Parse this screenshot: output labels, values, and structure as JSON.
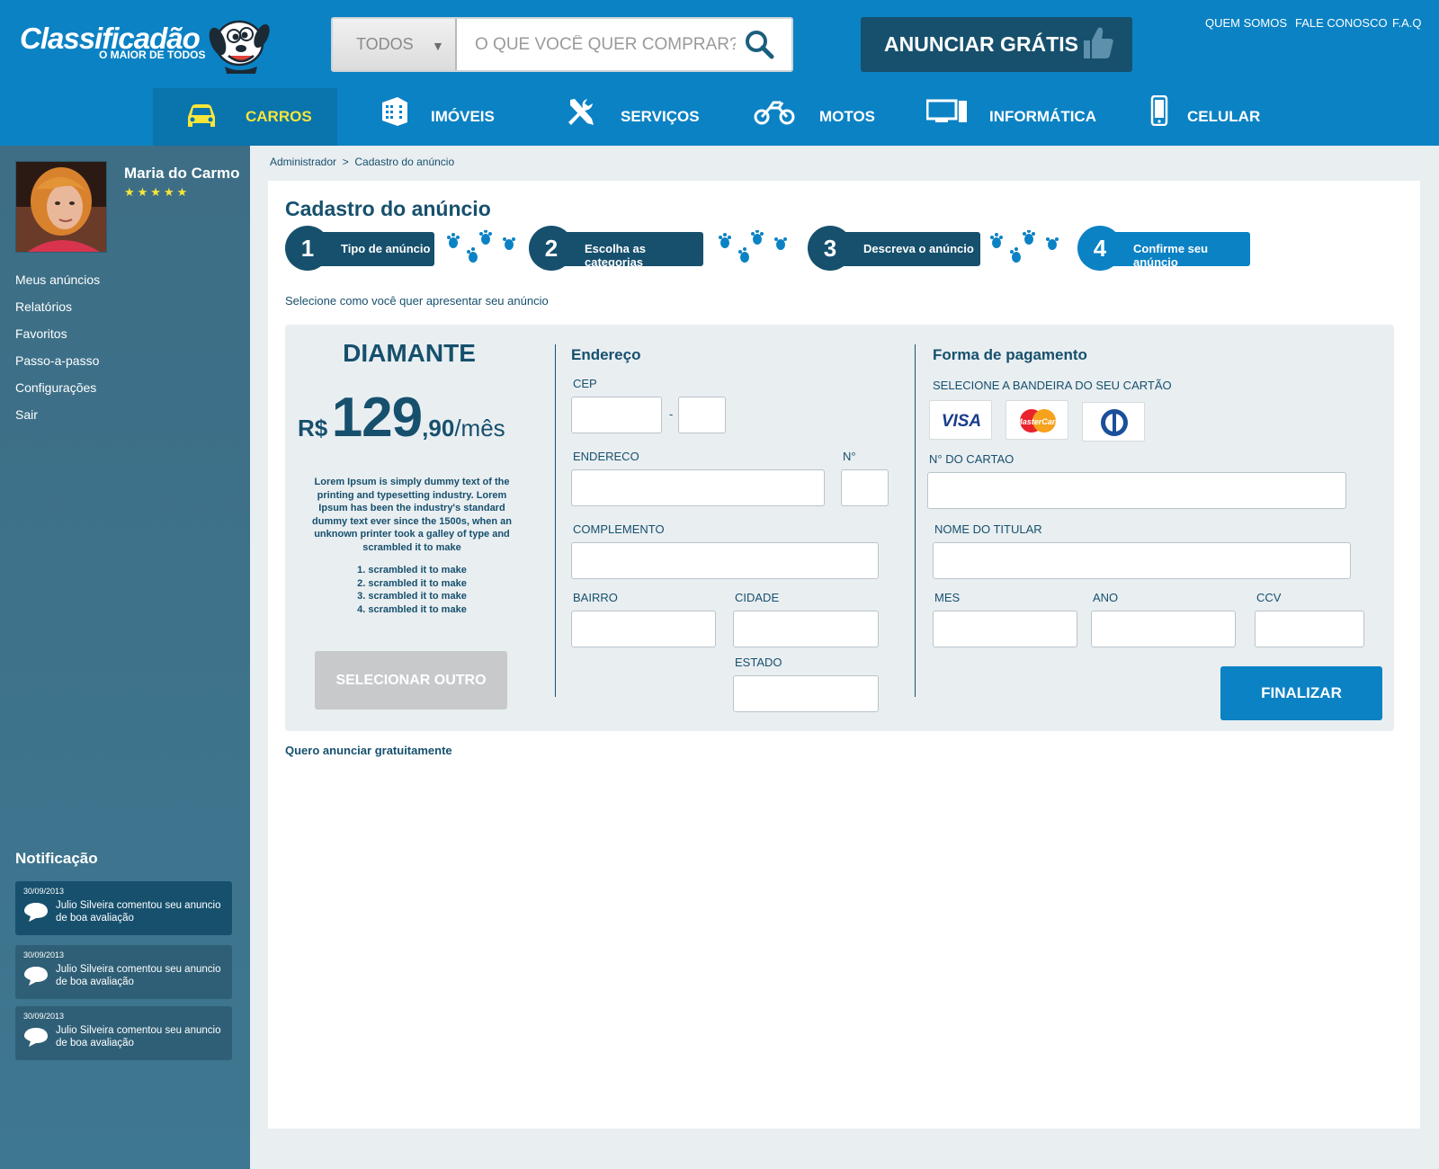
{
  "header": {
    "logo_text": "Classificadão",
    "logo_tagline": "O MAIOR DE TODOS",
    "search": {
      "category": "TODOS",
      "placeholder": "O QUE VOCÊ QUER COMPRAR?"
    },
    "cta_label": "ANUNCIAR GRÁTIS",
    "top_links": [
      "QUEM SOMOS",
      "FALE CONOSCO",
      "F.A.Q"
    ]
  },
  "nav": {
    "items": [
      {
        "label": "CARROS",
        "icon": "car-icon",
        "active": true
      },
      {
        "label": "IMÓVEIS",
        "icon": "building-icon",
        "active": false
      },
      {
        "label": "SERVIÇOS",
        "icon": "tools-icon",
        "active": false
      },
      {
        "label": "MOTOS",
        "icon": "motorcycle-icon",
        "active": false
      },
      {
        "label": "INFORMÁTICA",
        "icon": "computer-icon",
        "active": false
      },
      {
        "label": "CELULAR",
        "icon": "phone-icon",
        "active": false
      }
    ]
  },
  "sidebar": {
    "user_name": "Maria do Carmo",
    "rating": 5,
    "rating_stars": "★★★★★",
    "links": [
      "Meus anúncios",
      "Relatórios",
      "Favoritos",
      "Passo-a-passo",
      "Configurações",
      "Sair"
    ],
    "notifications_title": "Notificação",
    "notifications": [
      {
        "date": "30/09/2013",
        "text": "Julio Silveira comentou seu anuncio de boa avaliação"
      },
      {
        "date": "30/09/2013",
        "text": "Julio Silveira comentou seu anuncio de boa avaliação"
      },
      {
        "date": "30/09/2013",
        "text": "Julio Silveira comentou seu anuncio de boa avaliação"
      }
    ]
  },
  "breadcrumb": {
    "root": "Administrador",
    "separator": ">",
    "current": "Cadastro do anúncio"
  },
  "page": {
    "title": "Cadastro do anúncio",
    "steps": [
      {
        "number": "1",
        "label": "Tipo de anúncio"
      },
      {
        "number": "2",
        "label": "Escolha as categorias"
      },
      {
        "number": "3",
        "label": "Descreva o anúncio"
      },
      {
        "number": "4",
        "label": "Confirme seu anúncio"
      }
    ],
    "subtitle": "Selecione como você quer apresentar seu anúncio",
    "free_link": "Quero anunciar gratuitamente"
  },
  "plan": {
    "name": "DIAMANTE",
    "currency": "R$",
    "price_int": "129",
    "price_dec": ",90",
    "period": "/mês",
    "description": "Lorem Ipsum is simply dummy text of the printing and typesetting industry. Lorem Ipsum has been the industry's standard dummy text ever since the 1500s, when an unknown printer took a galley of type and scrambled it to make",
    "list": [
      "1. scrambled it to make",
      "2. scrambled it to make",
      "3. scrambled it to make",
      "4. scrambled it to make"
    ],
    "button": "SELECIONAR OUTRO"
  },
  "address": {
    "title": "Endereço",
    "cep_label": "CEP",
    "cep_sep": "-",
    "endereco_label": "ENDERECO",
    "numero_label": "N°",
    "complemento_label": "COMPLEMENTO",
    "bairro_label": "BAIRRO",
    "cidade_label": "CIDADE",
    "estado_label": "ESTADO"
  },
  "payment": {
    "title": "Forma de pagamento",
    "brand_label": "SELECIONE A BANDEIRA DO SEU CARTÃO",
    "brands": [
      "VISA",
      "MasterCard",
      "Diners"
    ],
    "card_number_label": "N° DO CARTAO",
    "holder_label": "NOME DO TITULAR",
    "month_label": "MES",
    "year_label": "ANO",
    "ccv_label": "CCV",
    "submit": "FINALIZAR"
  },
  "colors": {
    "brand_blue": "#0b82c4",
    "dark_blue": "#16506d",
    "sidebar": "#3d6e85",
    "accent_yellow": "#f7e63a",
    "step_active": "#0b82c4"
  }
}
